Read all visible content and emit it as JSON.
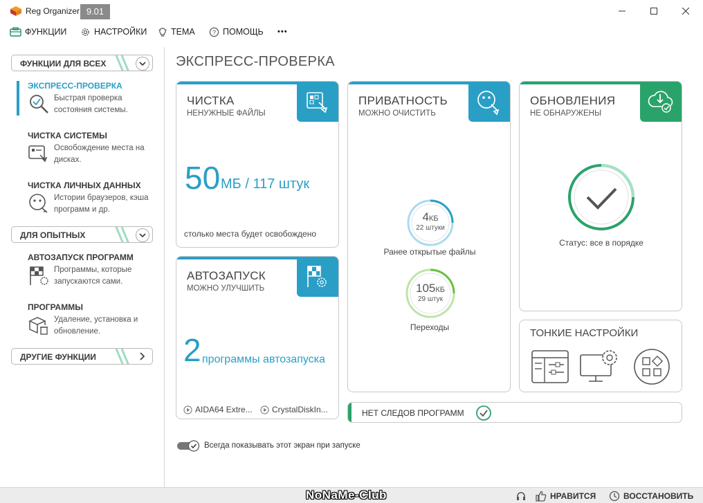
{
  "window": {
    "title": "Reg Organizer",
    "version": "9.01"
  },
  "menu": [
    {
      "label": "ФУНКЦИИ",
      "icon": "functions-icon"
    },
    {
      "label": "НАСТРОЙКИ",
      "icon": "gear-icon"
    },
    {
      "label": "ТЕМА",
      "icon": "lightbulb-icon"
    },
    {
      "label": "ПОМОЩЬ",
      "icon": "help-icon"
    },
    {
      "label": "•••",
      "icon": "more-icon"
    }
  ],
  "sidebar": {
    "sections": [
      {
        "label": "ФУНКЦИИ ДЛЯ ВСЕХ"
      },
      {
        "label": "ДЛЯ ОПЫТНЫХ"
      },
      {
        "label": "ДРУГИЕ ФУНКЦИИ"
      }
    ],
    "items": [
      {
        "title": "ЭКСПРЕСС-ПРОВЕРКА",
        "desc": "Быстрая проверка состояния системы.",
        "icon": "magnifier-check-icon"
      },
      {
        "title": "ЧИСТКА СИСТЕМЫ",
        "desc": "Освобождение места на дисках.",
        "icon": "disk-cleanup-icon"
      },
      {
        "title": "ЧИСТКА ЛИЧНЫХ ДАННЫХ",
        "desc": "Истории браузеров, кэша программ и др.",
        "icon": "privacy-cleanup-icon"
      },
      {
        "title": "АВТОЗАПУСК ПРОГРАММ",
        "desc": "Программы, которые запускаются сами.",
        "icon": "autostart-flag-icon"
      },
      {
        "title": "ПРОГРАММЫ",
        "desc": "Удаление, установка и обновление.",
        "icon": "programs-box-icon"
      }
    ]
  },
  "main": {
    "title": "ЭКСПРЕСС-ПРОВЕРКА",
    "cleanup": {
      "title": "ЧИСТКА",
      "subtitle": "НЕНУЖНЫЕ ФАЙЛЫ",
      "size": "50",
      "size_unit": "МБ / 117 штук",
      "note": "столько места будет освобождено"
    },
    "autostart": {
      "title": "АВТОЗАПУСК",
      "subtitle": "МОЖНО УЛУЧШИТЬ",
      "count": "2",
      "count_label": "программы автозапуска",
      "apps": [
        "AIDA64 Extre...",
        "CrystalDiskIn..."
      ]
    },
    "privacy": {
      "title": "ПРИВАТНОСТЬ",
      "subtitle": "МОЖНО ОЧИСТИТЬ",
      "recent": {
        "value": "4",
        "unit": "КБ",
        "count": "22 штуки",
        "label": "Ранее открытые файлы"
      },
      "history": {
        "value": "105",
        "unit": "КБ",
        "count": "29 штук",
        "label": "Переходы"
      }
    },
    "updates": {
      "title": "ОБНОВЛЕНИЯ",
      "subtitle": "НЕ ОБНАРУЖЕНЫ",
      "status": "Статус: все в порядке"
    },
    "tweaks": {
      "title": "ТОНКИЕ НАСТРОЙКИ"
    },
    "no_traces": {
      "label": "НЕТ СЛЕДОВ ПРОГРАММ"
    },
    "startup_toggle": {
      "label": "Всегда показывать этот экран при запуске",
      "on": true
    }
  },
  "footer": {
    "like": "НРАВИТСЯ",
    "restore": "ВОССТАНОВИТЬ",
    "watermark": "NoNaMe-Club"
  },
  "colors": {
    "accent_blue": "#2a9fc6",
    "accent_green": "#2aa36b"
  }
}
